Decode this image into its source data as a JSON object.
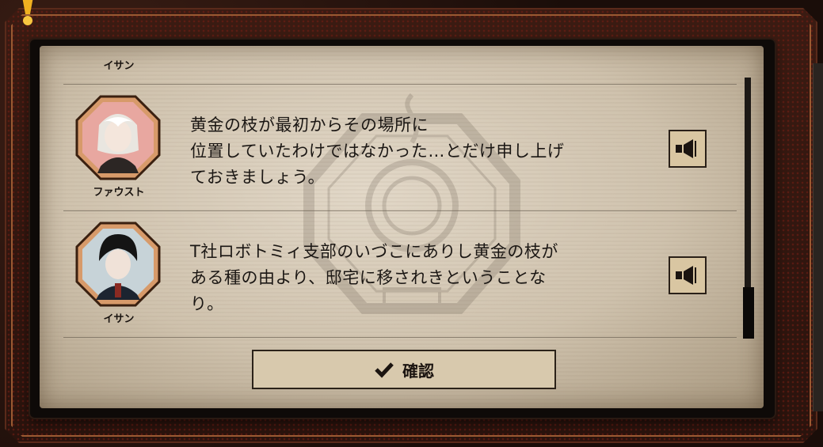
{
  "dialog_log": {
    "entries": [
      {
        "speaker": "イサン",
        "text_lines": [],
        "partial": true
      },
      {
        "speaker": "ファウスト",
        "text_lines": [
          "黄金の枝が最初からその場所に",
          "位置していたわけではなかった…とだけ申し上げ",
          "ておきましょう。"
        ],
        "voice_icon": "speaker-icon"
      },
      {
        "speaker": "イサン",
        "text_lines": [
          "T社ロボトミィ支部のいづこにありし黄金の枝が",
          "ある種の由より、邸宅に移されきということな",
          "り。"
        ],
        "voice_icon": "speaker-icon"
      }
    ],
    "confirm_label": "確認",
    "confirm_icon": "checkmark-icon"
  },
  "colors": {
    "paper": "#d6cab6",
    "frame_orange": "#9a5a32",
    "button_fill": "#d8c9ad",
    "text": "#1b1714"
  }
}
